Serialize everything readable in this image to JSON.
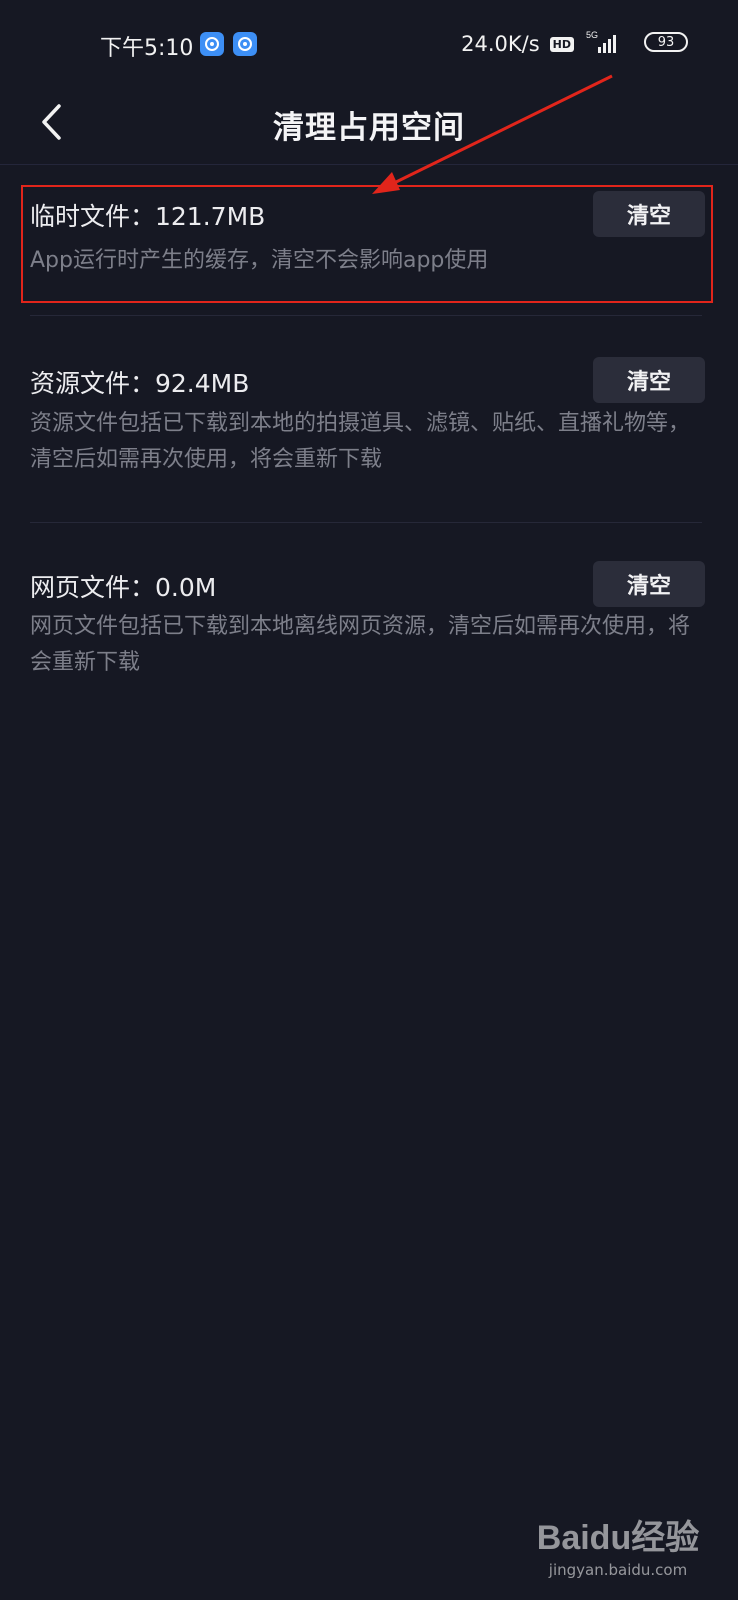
{
  "status_bar": {
    "time": "下午5:10",
    "net_speed": "24.0K/s",
    "hd": "HD",
    "network": "5G",
    "battery": "93"
  },
  "nav": {
    "title": "清理占用空间",
    "back_icon": "chevron-left-icon"
  },
  "items": [
    {
      "title": "临时文件：121.7MB",
      "description": "App运行时产生的缓存，清空不会影响app使用",
      "button": "清空"
    },
    {
      "title": "资源文件：92.4MB",
      "description": "资源文件包括已下载到本地的拍摄道具、滤镜、贴纸、直播礼物等，清空后如需再次使用，将会重新下载",
      "button": "清空"
    },
    {
      "title": "网页文件：0.0M",
      "description": "网页文件包括已下载到本地离线网页资源，清空后如需再次使用，将会重新下载",
      "button": "清空"
    }
  ],
  "annotation": {
    "color": "#e1251b"
  },
  "watermark": {
    "logo": "Baidu经验",
    "url": "jingyan.baidu.com"
  },
  "colors": {
    "background": "#161823",
    "button_bg": "#2b2d3a",
    "secondary_text": "#7d7f8a"
  }
}
